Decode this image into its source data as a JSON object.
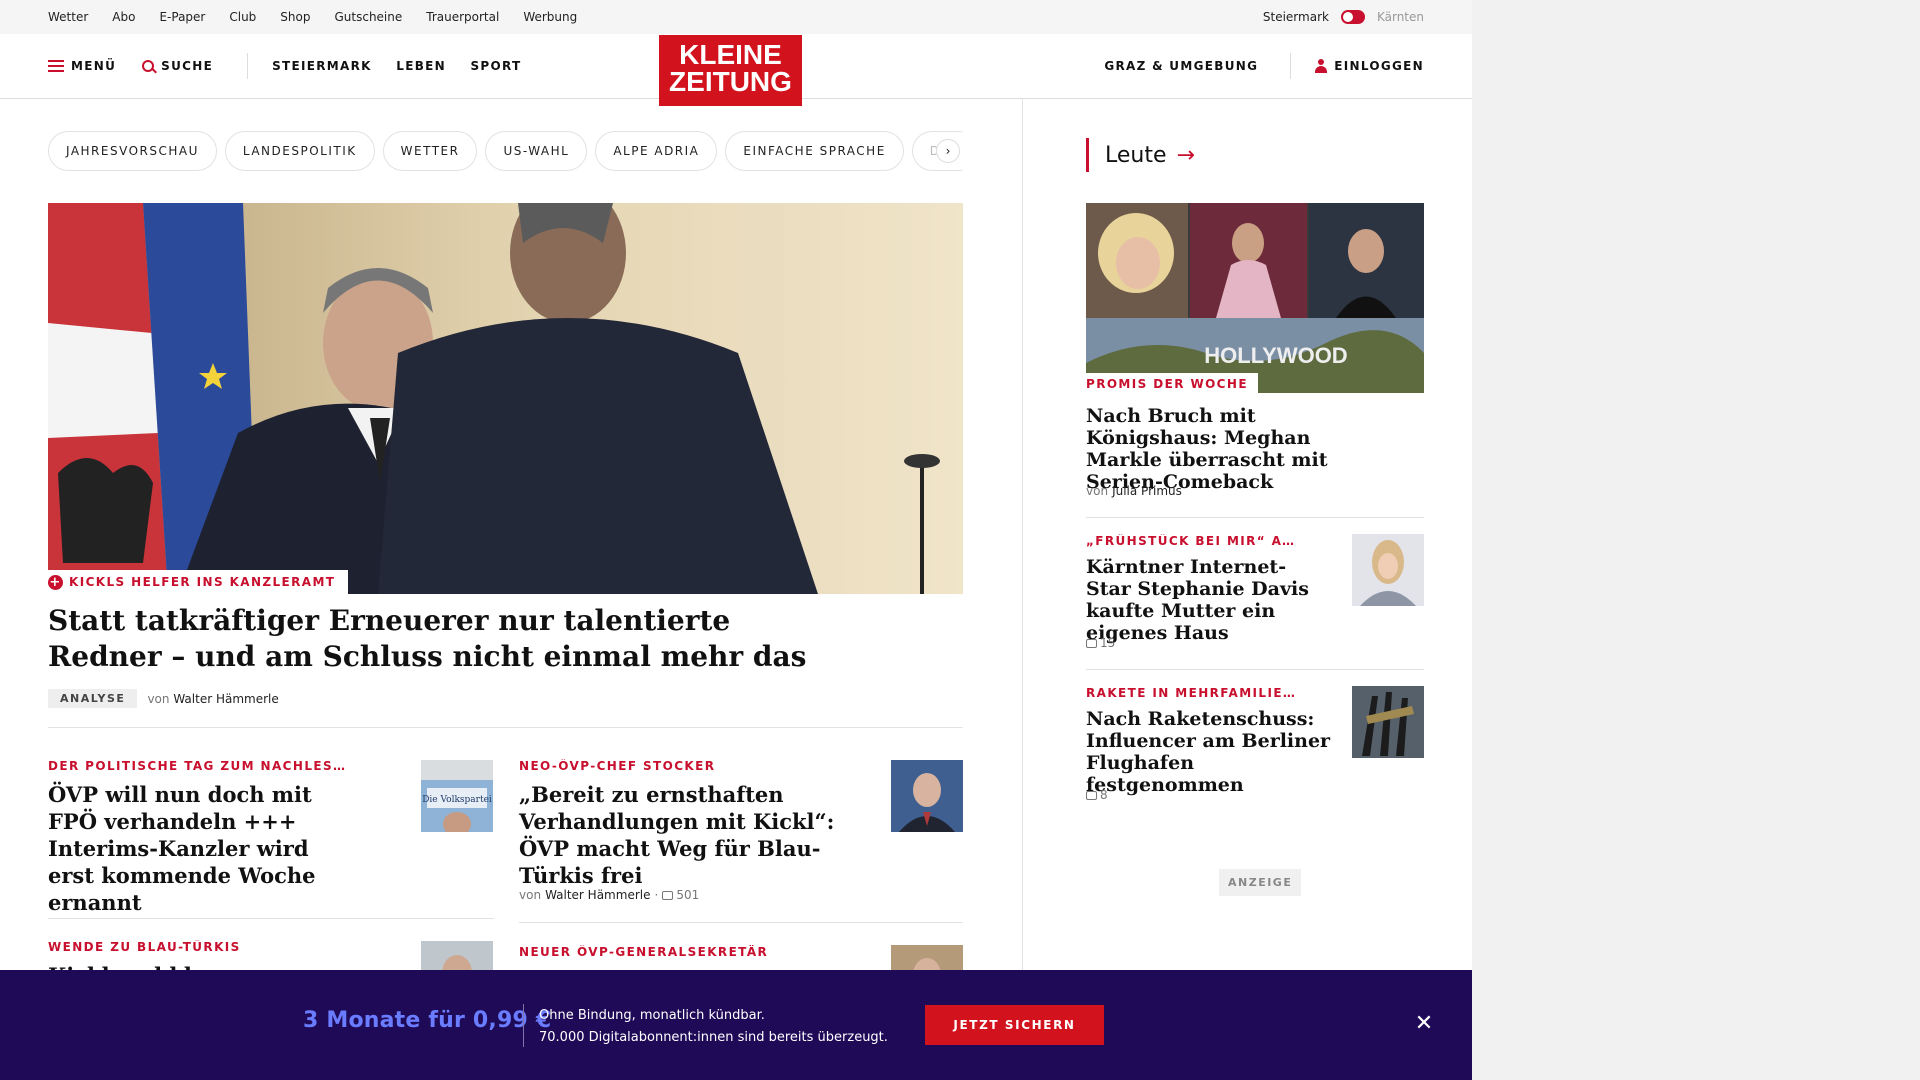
{
  "topbar": {
    "links": [
      "Wetter",
      "Abo",
      "E-Paper",
      "Club",
      "Shop",
      "Gutscheine",
      "Trauerportal",
      "Werbung"
    ],
    "region_left": "Steiermark",
    "region_right": "Kärnten"
  },
  "header": {
    "menu_label": "MENÜ",
    "search_label": "SUCHE",
    "sections": [
      "STEIERMARK",
      "LEBEN",
      "SPORT"
    ],
    "logo_line1": "KLEINE",
    "logo_line2": "ZEITUNG",
    "region_label": "GRAZ & UMGEBUNG",
    "login_label": "EINLOGGEN"
  },
  "topics": [
    "JAHRESVORSCHAU",
    "LANDESPOLITIK",
    "WETTER",
    "US-WAHL",
    "ALPE ADRIA",
    "EINFACHE SPRACHE",
    "DOS"
  ],
  "hero": {
    "kicker": "KICKLS HELFER INS KANZLERAMT",
    "title": "Statt tatkräftiger Erneuerer nur talentierte Redner – und am Schluss nicht einmal mehr das",
    "tag": "ANALYSE",
    "by": "von",
    "author": "Walter Hämmerle"
  },
  "articles": [
    {
      "kicker": "DER POLITISCHE TAG ZUM NACHLESEN",
      "title": "ÖVP will nun doch mit FPÖ verhandeln +++ Interims-Kanzler wird erst kommende Woche ernannt",
      "thumb_text": "Die Volkspartei"
    },
    {
      "kicker": "NEO-ÖVP-CHEF STOCKER",
      "title": "„Bereit zu ernsthaften Verhandlungen mit Kickl“: ÖVP macht Weg für Blau-Türkis frei",
      "by": "von",
      "author": "Walter Hämmerle",
      "comments": "501"
    },
    {
      "kicker": "WENDE ZU BLAU-TÜRKIS",
      "title": "Kickl und kl..."
    },
    {
      "kicker": "NEUER ÖVP-GENERALSEKRETÄR",
      "title": ""
    }
  ],
  "sidebar": {
    "section_title": "Leute",
    "lead": {
      "kicker": "PROMIS DER WOCHE",
      "title": "Nach Bruch mit Königshaus: Meghan Markle überrascht mit Serien-Comeback",
      "by": "von",
      "author": "Julia Primus",
      "collage_text": "HOLLYWOOD"
    },
    "items": [
      {
        "kicker": "„FRÜHSTÜCK BEI MIR“ AUF ...",
        "title": "Kärntner Internet-Star Stephanie Davis kaufte Mutter ein eigenes Haus",
        "comments": "15"
      },
      {
        "kicker": "RAKETE IN MEHRFAMILIEN...",
        "title": "Nach Raketenschuss: Influencer am Berliner Flughafen festgenommen",
        "comments": "8"
      }
    ],
    "ad_label": "ANZEIGE"
  },
  "banner": {
    "price": "3 Monate für 0,99 €",
    "line1": "Ohne Bindung, monatlich kündbar.",
    "line2": "70.000 Digitalabonnent:innen sind bereits überzeugt.",
    "cta": "JETZT SICHERN"
  },
  "colors": {
    "brand_red": "#d2121c",
    "banner_bg": "#1f0a57",
    "price_blue": "#6a7cff"
  }
}
